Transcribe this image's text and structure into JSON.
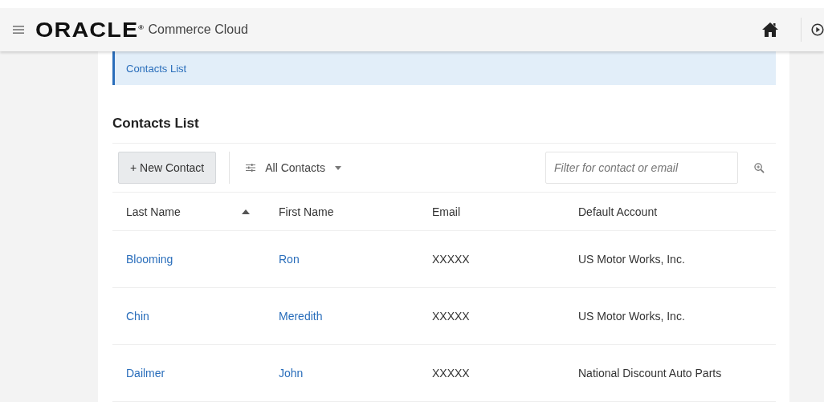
{
  "header": {
    "logo": "ORACLE$^{®}$",
    "product": "Commerce Cloud"
  },
  "breadcrumb": "Contacts List",
  "title": "Contacts List",
  "toolbar": {
    "new_button": "+ New Contact",
    "filter_menu": "All Contacts",
    "search": {
      "placeholder": "Filter for contact or email"
    }
  },
  "table": {
    "columns": [
      {
        "label": "Last Name",
        "sorted": true
      },
      {
        "label": "First Name",
        "sorted": false
      },
      {
        "label": "Email",
        "sorted": false
      },
      {
        "label": "Default Account",
        "sorted": false
      }
    ],
    "rows": [
      {
        "last_name": "Blooming",
        "first_name": "Ron",
        "email": "XXXXX",
        "account": "US Motor Works, Inc."
      },
      {
        "last_name": "Chin",
        "first_name": "Meredith",
        "email": "XXXXX",
        "account": "US Motor Works, Inc."
      },
      {
        "last_name": "Dailmer",
        "first_name": "John",
        "email": "XXXXX",
        "account": "National Discount Auto Parts"
      }
    ]
  }
}
